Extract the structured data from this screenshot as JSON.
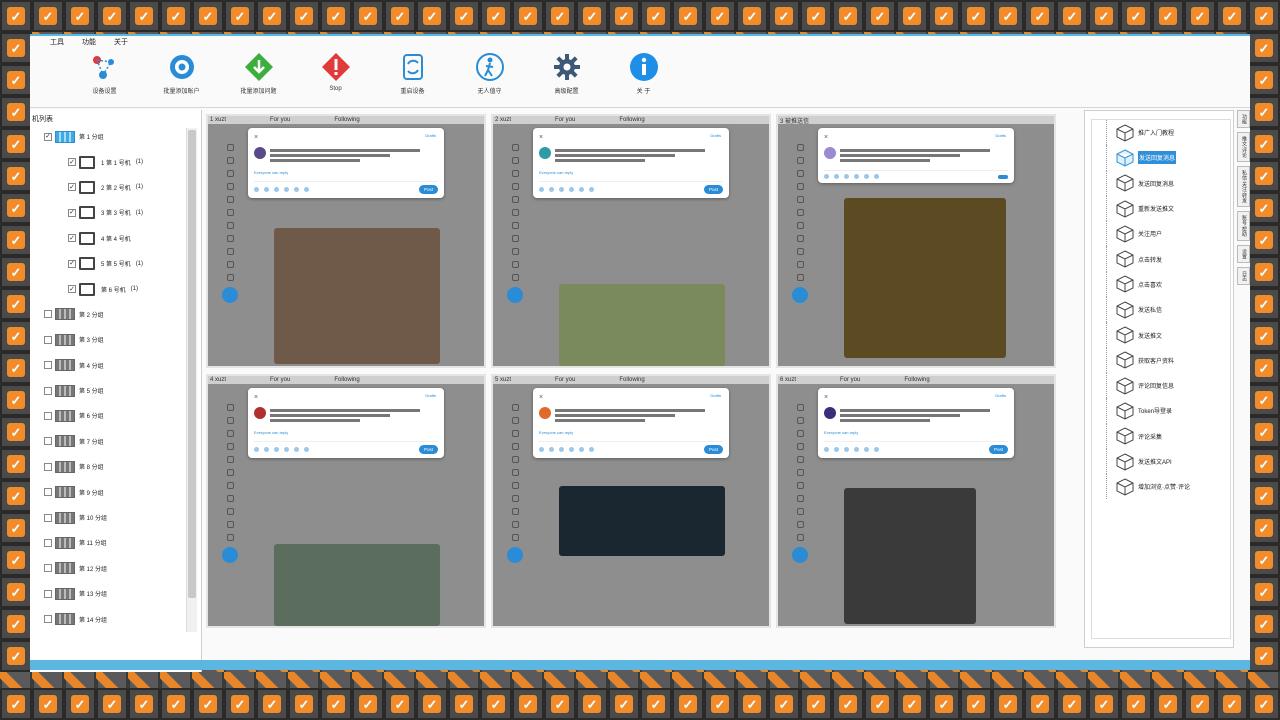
{
  "menu": [
    "",
    "工具",
    "功能",
    "关于"
  ],
  "toolbar": [
    {
      "label": "设备设置",
      "icon": "network-icon"
    },
    {
      "label": "批量添加账户",
      "icon": "disc-icon"
    },
    {
      "label": "批量添加问题",
      "icon": "download-icon"
    },
    {
      "label": "Stop",
      "icon": "stop-icon"
    },
    {
      "label": "重启设备",
      "icon": "restart-icon"
    },
    {
      "label": "无人值守",
      "icon": "walker-icon"
    },
    {
      "label": "高级配置",
      "icon": "gear-icon"
    },
    {
      "label": "关 于",
      "icon": "info-icon"
    }
  ],
  "tree": {
    "header": "机列表",
    "groups": [
      {
        "label": "第 1 分组",
        "checked": true,
        "active": true,
        "devices": [
          {
            "label": "1 第 1 号机",
            "count": "(1)"
          },
          {
            "label": "2 第 2 号机",
            "count": "(1)"
          },
          {
            "label": "3 第 3 号机",
            "count": "(1)"
          },
          {
            "label": "4 第 4 号机",
            "count": ""
          },
          {
            "label": "5 第 5 号机",
            "count": "(1)"
          },
          {
            "label": "第 6 号机",
            "count": "(1)"
          }
        ]
      },
      {
        "label": "第 2 分组"
      },
      {
        "label": "第 3 分组"
      },
      {
        "label": "第 4 分组"
      },
      {
        "label": "第 5 分组"
      },
      {
        "label": "第 6 分组"
      },
      {
        "label": "第 7 分组"
      },
      {
        "label": "第 8 分组"
      },
      {
        "label": "第 9 分组"
      },
      {
        "label": "第 10 分组"
      },
      {
        "label": "第 11 分组"
      },
      {
        "label": "第 12 分组"
      },
      {
        "label": "第 13 分组"
      },
      {
        "label": "第 14 分组"
      }
    ]
  },
  "cells": [
    {
      "head": "1 xuzt",
      "tab": "For you",
      "tab2": "Following",
      "drafts": "Drafts",
      "reply": "Everyone can reply",
      "post": "Post",
      "avatar": "#5a4a8c",
      "media": "#6f5a49"
    },
    {
      "head": "2 xuzt",
      "tab": "For you",
      "tab2": "Following",
      "drafts": "Drafts",
      "reply": "Everyone can reply",
      "post": "Post",
      "avatar": "#2d9aa8",
      "media": "#7a8a5c"
    },
    {
      "head": "3 被推送信",
      "tab": "",
      "tab2": "",
      "drafts": "Drafts",
      "reply": "",
      "post": "",
      "avatar": "#9a8ad0",
      "media": "#5c4a22"
    },
    {
      "head": "4 xuzt",
      "tab": "For you",
      "tab2": "Following",
      "drafts": "Drafts",
      "reply": "Everyone can reply",
      "post": "Post",
      "avatar": "#b0302e",
      "media": "#5b6e5d"
    },
    {
      "head": "5 xuzt",
      "tab": "For you",
      "tab2": "Following",
      "drafts": "Drafts",
      "reply": "Everyone can reply",
      "post": "Post",
      "avatar": "#e06a2a",
      "media": "#1a2630"
    },
    {
      "head": "6 xuzt",
      "tab": "For you",
      "tab2": "Following",
      "drafts": "Drafts",
      "reply": "Everyone can reply",
      "post": "Post",
      "avatar": "#3c2d7a",
      "media": "#3a3a3a"
    }
  ],
  "functions": [
    {
      "label": "推广入门教程"
    },
    {
      "label": "发送回复消息",
      "selected": true
    },
    {
      "label": "发送回复消息"
    },
    {
      "label": "重新发送推文"
    },
    {
      "label": "关注用户"
    },
    {
      "label": "点击转发"
    },
    {
      "label": "点击喜欢"
    },
    {
      "label": "发送私信"
    },
    {
      "label": "发送推文"
    },
    {
      "label": "获取客户资料"
    },
    {
      "label": "评论回复信息"
    },
    {
      "label": "Token导登录"
    },
    {
      "label": "评论采集"
    },
    {
      "label": "发送推文API"
    },
    {
      "label": "增加浏览·点赞·评论"
    }
  ],
  "vtabs": [
    "功能",
    "推文·评论",
    "私信·关注·转发",
    "账号·帮助",
    "设置",
    "日志"
  ]
}
